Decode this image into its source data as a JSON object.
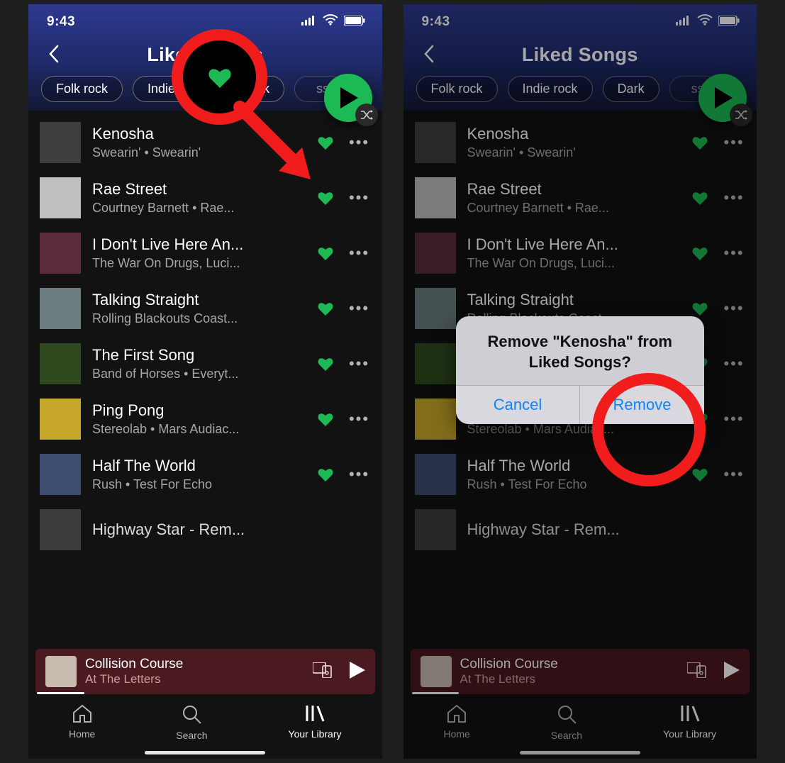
{
  "status": {
    "time": "9:43"
  },
  "header": {
    "title": "Liked Songs"
  },
  "chips": [
    "Folk rock",
    "Indie rock",
    "Dark"
  ],
  "shuffle_tail": "ss",
  "tracks": [
    {
      "title": "Kenosha",
      "sub": "Swearin' • Swearin'"
    },
    {
      "title": "Rae Street",
      "sub": "Courtney Barnett • Rae..."
    },
    {
      "title": "I Don't Live Here An...",
      "sub": "The War On Drugs, Luci..."
    },
    {
      "title": "Talking Straight",
      "sub": "Rolling Blackouts Coast..."
    },
    {
      "title": "The First Song",
      "sub": "Band of Horses • Everyt..."
    },
    {
      "title": "Ping Pong",
      "sub": "Stereolab • Mars Audiac..."
    },
    {
      "title": "Half The World",
      "sub": "Rush • Test For Echo"
    },
    {
      "title": "Highway Star - Rem...",
      "sub": ""
    }
  ],
  "now_playing": {
    "title": "Collision Course",
    "sub": "At The Letters"
  },
  "tabs": {
    "home": "Home",
    "search": "Search",
    "library": "Your Library"
  },
  "alert": {
    "message": "Remove \"Kenosha\" from Liked Songs?",
    "cancel": "Cancel",
    "remove": "Remove"
  },
  "colors": {
    "spotify_green": "#1db954",
    "ios_blue": "#0a84ff",
    "annotation_red": "#f11d1d"
  }
}
